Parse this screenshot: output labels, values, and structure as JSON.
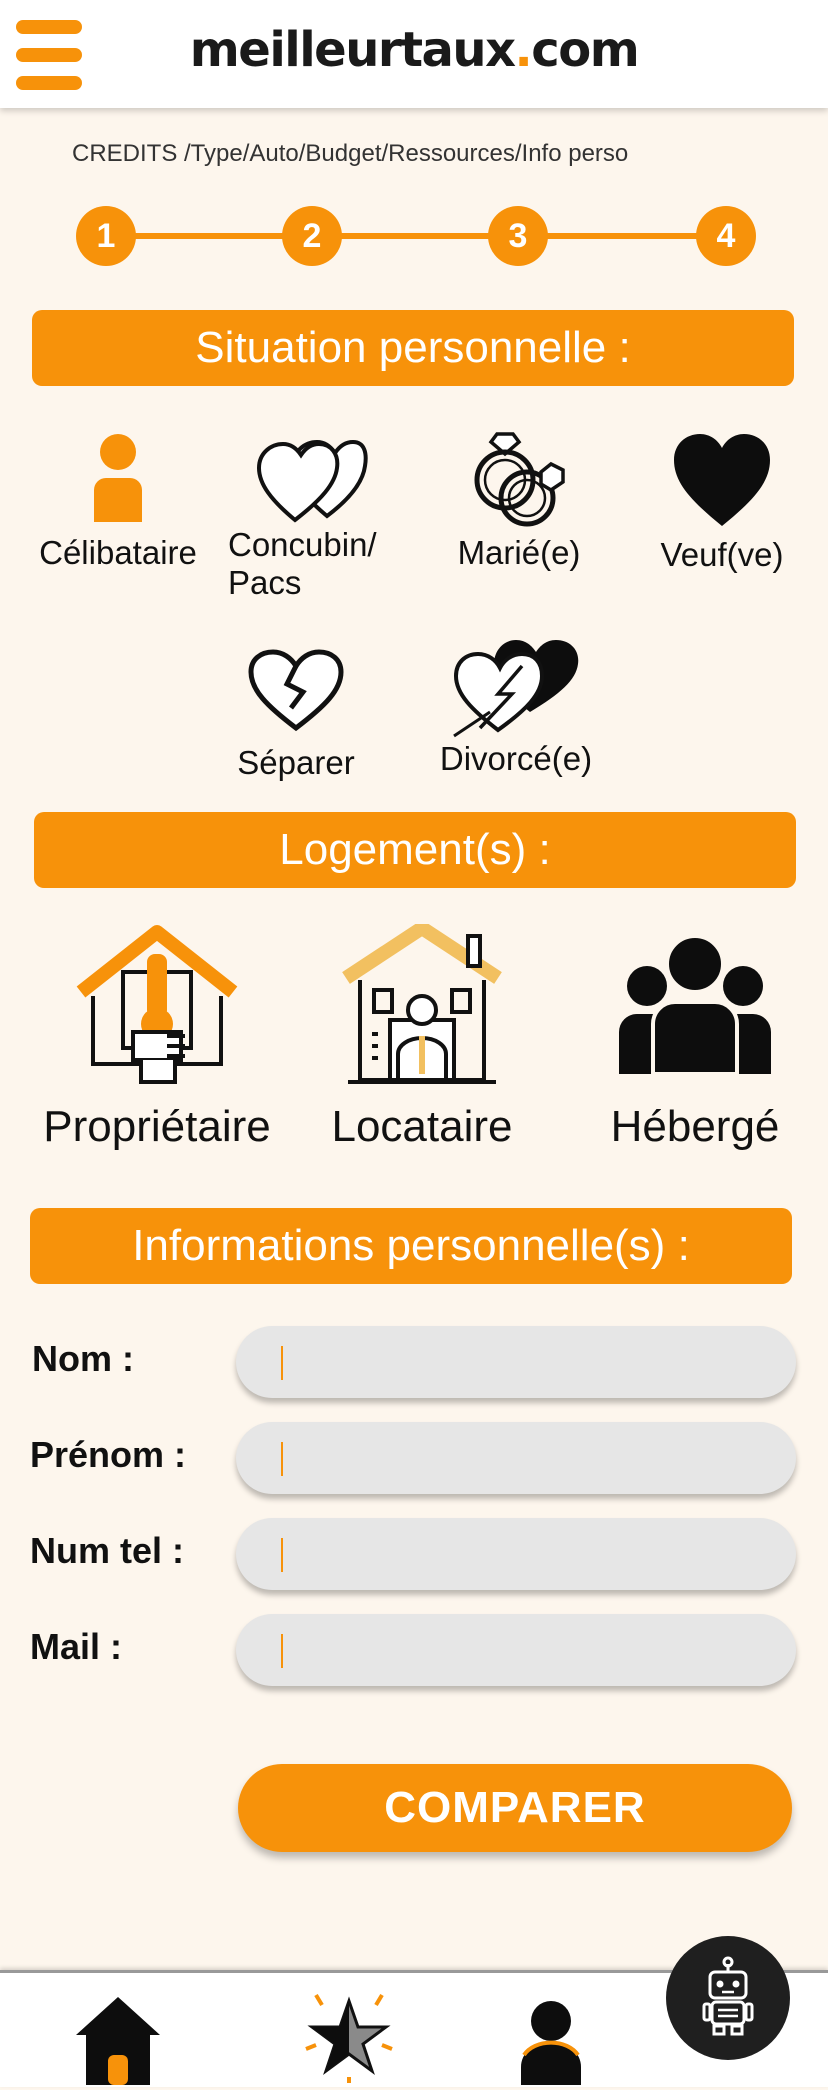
{
  "header": {
    "logo_main": "meilleurtaux",
    "logo_dot": ".",
    "logo_tld": "com",
    "menu_icon": "hamburger-menu-icon",
    "accent_color": "#f7920a"
  },
  "breadcrumb": "CREDITS /Type/Auto/Budget/Ressources/Info perso",
  "stepper": {
    "steps": [
      "1",
      "2",
      "3",
      "4"
    ]
  },
  "sections": {
    "situation": "Situation personnelle :",
    "logement": "Logement(s) :",
    "informations": "Informations personnelle(s) :"
  },
  "situation_options": [
    {
      "label": "Célibataire",
      "icon": "person-icon"
    },
    {
      "label": "Concubin/",
      "label2": "Pacs",
      "icon": "two-hearts-icon"
    },
    {
      "label": "Marié(e)",
      "icon": "wedding-rings-icon"
    },
    {
      "label": "Veuf(ve)",
      "icon": "black-heart-icon"
    },
    {
      "label": "Séparer",
      "icon": "broken-heart-icon"
    },
    {
      "label": "Divorcé(e)",
      "icon": "divorce-hearts-icon"
    }
  ],
  "logement_options": [
    {
      "label": "Propriétaire",
      "icon": "owner-house-key-icon"
    },
    {
      "label": "Locataire",
      "icon": "tenant-house-icon"
    },
    {
      "label": "Hébergé",
      "icon": "group-people-icon"
    }
  ],
  "form": {
    "fields": [
      {
        "label": "Nom :",
        "value": "",
        "placeholder": ""
      },
      {
        "label": "Prénom :",
        "value": "",
        "placeholder": ""
      },
      {
        "label": "Num tel :",
        "value": "",
        "placeholder": ""
      },
      {
        "label": "Mail :",
        "value": "",
        "placeholder": ""
      }
    ],
    "submit_label": "COMPARER"
  },
  "bottom_nav": {
    "items": [
      {
        "icon": "home-icon"
      },
      {
        "icon": "star-icon"
      },
      {
        "icon": "user-icon"
      }
    ],
    "assistant_icon": "robot-icon"
  }
}
